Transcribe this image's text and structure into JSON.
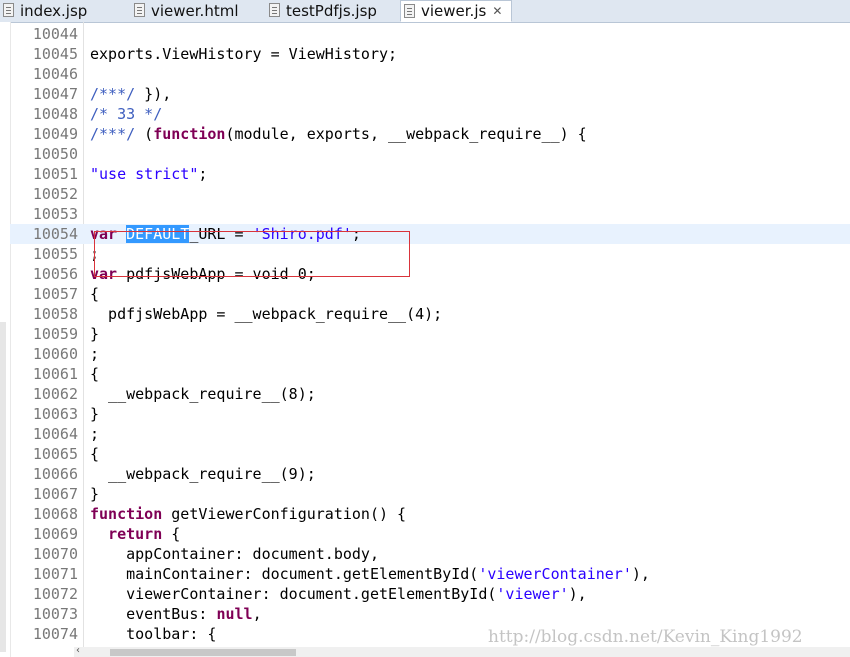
{
  "tabs": [
    {
      "label": "index.jsp",
      "icon": "file-icon"
    },
    {
      "label": "viewer.html",
      "icon": "file-icon"
    },
    {
      "label": "testPdfjs.jsp",
      "icon": "file-icon"
    },
    {
      "label": "viewer.js",
      "icon": "js-file-icon",
      "close": "✕",
      "active": true
    }
  ],
  "lines": [
    {
      "n": "10044",
      "parts": []
    },
    {
      "n": "10045",
      "parts": [
        {
          "t": "exports.ViewHistory = ViewHistory;",
          "c": ""
        }
      ]
    },
    {
      "n": "10046",
      "parts": []
    },
    {
      "n": "10047",
      "parts": [
        {
          "t": "/***/",
          "c": "docc"
        },
        {
          "t": " }),",
          "c": ""
        }
      ]
    },
    {
      "n": "10048",
      "parts": [
        {
          "t": "/* 33 */",
          "c": "docc"
        }
      ]
    },
    {
      "n": "10049",
      "parts": [
        {
          "t": "/***/",
          "c": "docc"
        },
        {
          "t": " (",
          "c": ""
        },
        {
          "t": "function",
          "c": "kw"
        },
        {
          "t": "(module, exports, __webpack_require__) {",
          "c": ""
        }
      ]
    },
    {
      "n": "10050",
      "parts": []
    },
    {
      "n": "10051",
      "parts": [
        {
          "t": "\"use strict\"",
          "c": "str"
        },
        {
          "t": ";",
          "c": ""
        }
      ]
    },
    {
      "n": "10052",
      "parts": []
    },
    {
      "n": "10053",
      "parts": []
    },
    {
      "n": "10054",
      "current": true,
      "parts": [
        {
          "t": "var",
          "c": "kw"
        },
        {
          "t": " ",
          "c": ""
        },
        {
          "t": "DEFAULT",
          "c": "sel"
        },
        {
          "t": "_URL = ",
          "c": ""
        },
        {
          "t": "'Shiro.pdf'",
          "c": "str"
        },
        {
          "t": ";",
          "c": ""
        }
      ]
    },
    {
      "n": "10055",
      "parts": [
        {
          "t": ";",
          "c": ""
        }
      ]
    },
    {
      "n": "10056",
      "parts": [
        {
          "t": "var",
          "c": "kw"
        },
        {
          "t": " pdfjsWebApp = void 0;",
          "c": ""
        }
      ]
    },
    {
      "n": "10057",
      "parts": [
        {
          "t": "{",
          "c": ""
        }
      ]
    },
    {
      "n": "10058",
      "parts": [
        {
          "t": "  pdfjsWebApp = __webpack_require__(4);",
          "c": ""
        }
      ]
    },
    {
      "n": "10059",
      "parts": [
        {
          "t": "}",
          "c": ""
        }
      ]
    },
    {
      "n": "10060",
      "parts": [
        {
          "t": ";",
          "c": ""
        }
      ]
    },
    {
      "n": "10061",
      "parts": [
        {
          "t": "{",
          "c": ""
        }
      ]
    },
    {
      "n": "10062",
      "parts": [
        {
          "t": "  __webpack_require__(8);",
          "c": ""
        }
      ]
    },
    {
      "n": "10063",
      "parts": [
        {
          "t": "}",
          "c": ""
        }
      ]
    },
    {
      "n": "10064",
      "parts": [
        {
          "t": ";",
          "c": ""
        }
      ]
    },
    {
      "n": "10065",
      "parts": [
        {
          "t": "{",
          "c": ""
        }
      ]
    },
    {
      "n": "10066",
      "parts": [
        {
          "t": "  __webpack_require__(9);",
          "c": ""
        }
      ]
    },
    {
      "n": "10067",
      "parts": [
        {
          "t": "}",
          "c": ""
        }
      ]
    },
    {
      "n": "10068",
      "parts": [
        {
          "t": "function",
          "c": "kw"
        },
        {
          "t": " getViewerConfiguration() {",
          "c": ""
        }
      ]
    },
    {
      "n": "10069",
      "parts": [
        {
          "t": "  ",
          "c": ""
        },
        {
          "t": "return",
          "c": "kw"
        },
        {
          "t": " {",
          "c": ""
        }
      ]
    },
    {
      "n": "10070",
      "parts": [
        {
          "t": "    appContainer: document.body,",
          "c": ""
        }
      ]
    },
    {
      "n": "10071",
      "parts": [
        {
          "t": "    mainContainer: document.getElementById(",
          "c": ""
        },
        {
          "t": "'viewerContainer'",
          "c": "str"
        },
        {
          "t": "),",
          "c": ""
        }
      ]
    },
    {
      "n": "10072",
      "parts": [
        {
          "t": "    viewerContainer: document.getElementById(",
          "c": ""
        },
        {
          "t": "'viewer'",
          "c": "str"
        },
        {
          "t": "),",
          "c": ""
        }
      ]
    },
    {
      "n": "10073",
      "parts": [
        {
          "t": "    eventBus: ",
          "c": ""
        },
        {
          "t": "null",
          "c": "kw"
        },
        {
          "t": ",",
          "c": ""
        }
      ]
    },
    {
      "n": "10074",
      "parts": [
        {
          "t": "    toolbar: {",
          "c": ""
        }
      ]
    }
  ],
  "watermark": "http://blog.csdn.net/Kevin_King1992",
  "colors": {
    "keyword": "#7f0055",
    "string": "#2a00ff",
    "comment": "#3f5fbf",
    "selection": "#3399ff",
    "highlight_box": "#d9343b"
  }
}
